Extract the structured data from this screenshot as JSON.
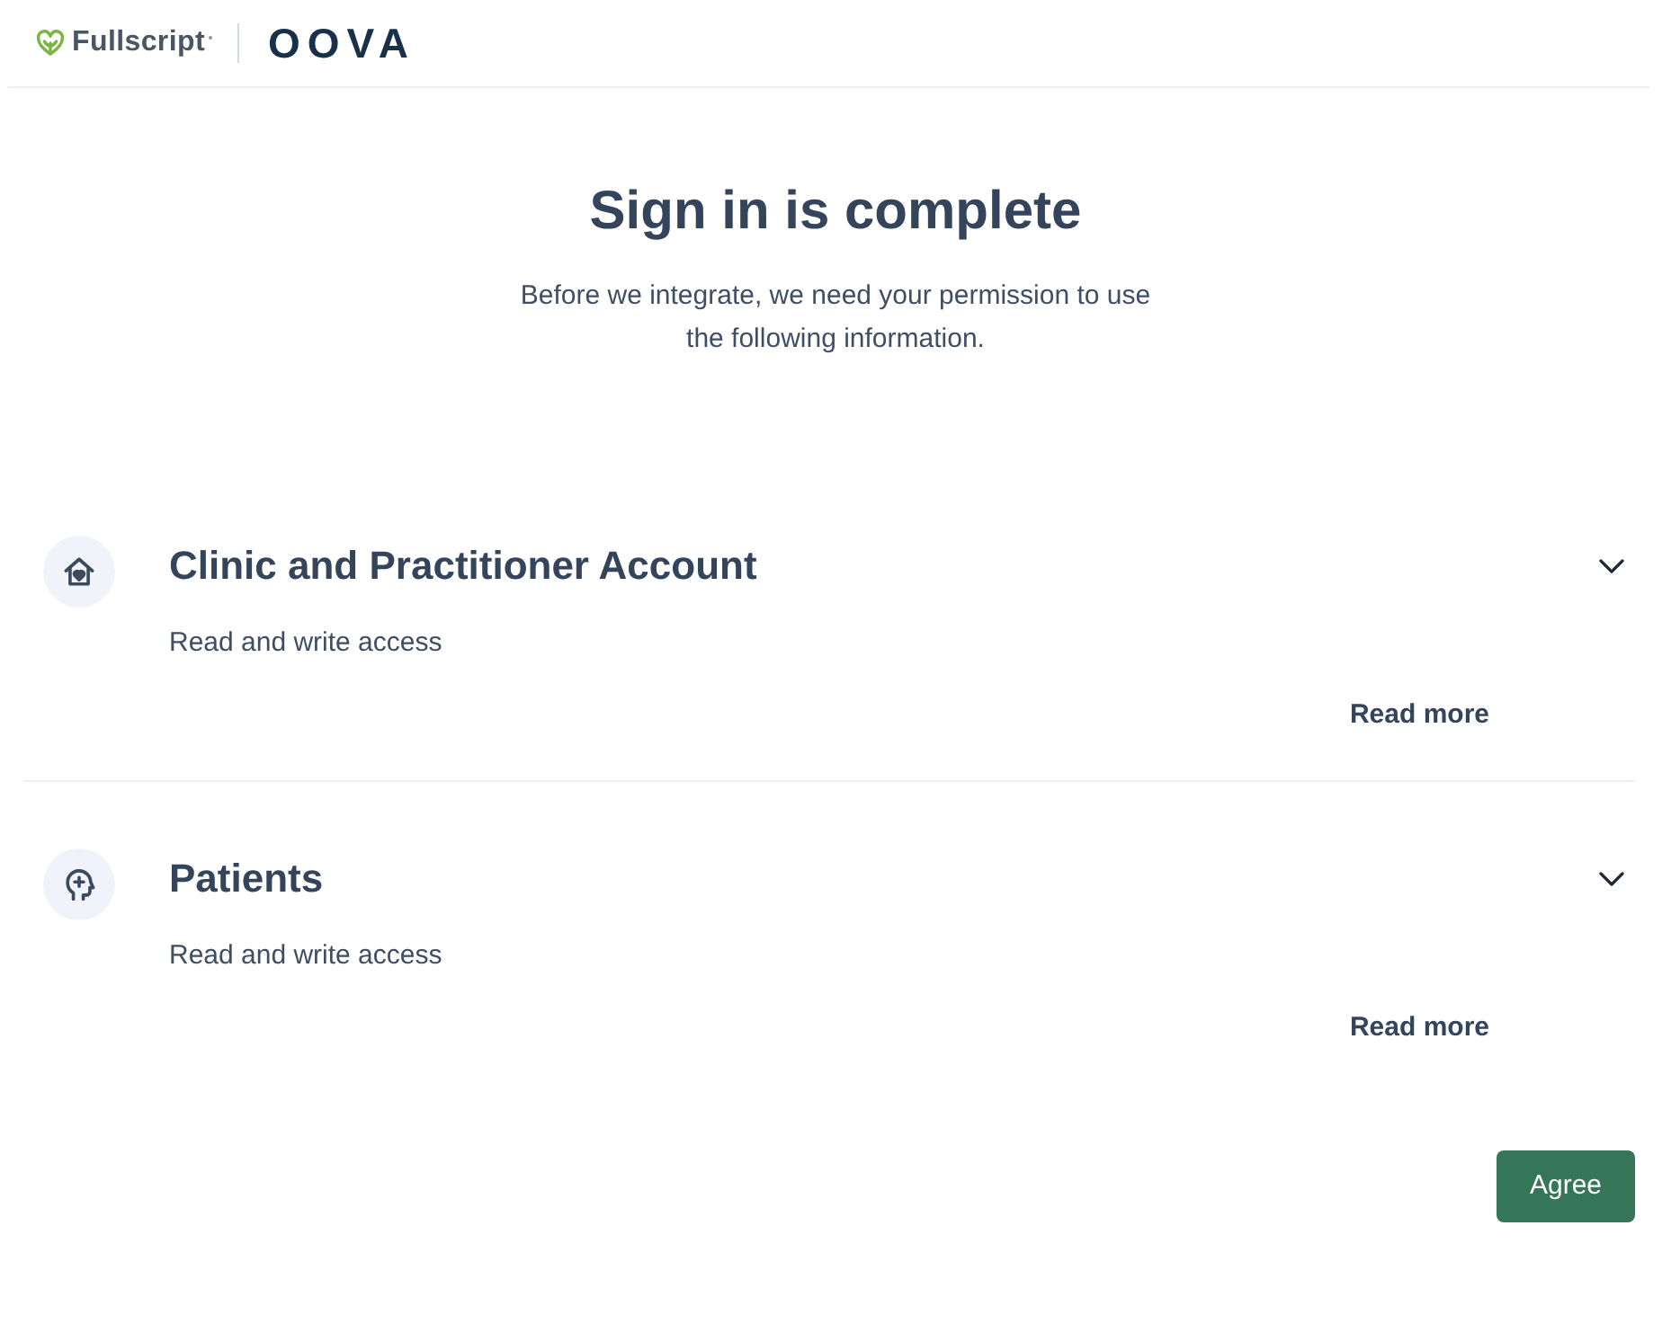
{
  "header": {
    "brand": "Fullscript",
    "partner": "OOVA"
  },
  "title": "Sign in is complete",
  "subtitle": "Before we integrate, we need your permission to use the following information.",
  "permissions": [
    {
      "title": "Clinic and Practitioner Account",
      "access": "Read and write access",
      "expanded": false,
      "link": "Read more"
    },
    {
      "title": "Patients",
      "access": "Read and write access",
      "expanded": false,
      "link": "Read more"
    }
  ],
  "agree_button": "Agree"
}
